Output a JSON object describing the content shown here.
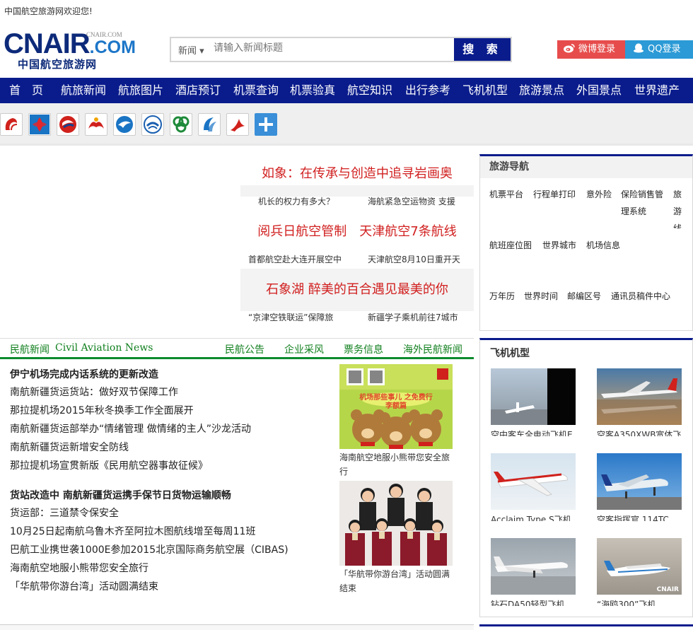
{
  "header": {
    "welcome": "中国航空旅游网欢迎您!",
    "logo_main": "CNAIR",
    "logo_dot": ".COM",
    "logo_small": "CNAIR.COM",
    "logo_cn": "中国航空旅游网"
  },
  "search": {
    "category": "新闻 ▾",
    "placeholder": "请输入新闻标题",
    "button": "搜 索"
  },
  "social": {
    "weibo": "微博登录",
    "qq": "QQ登录"
  },
  "nav": [
    "首　页",
    "航旅新闻",
    "航旅图片",
    "酒店预订",
    "机票查询",
    "机票验真",
    "航空知识",
    "出行参考",
    "飞机机型",
    "旅游景点",
    "外国景点",
    "世界遗产"
  ],
  "airlines": [
    "air-china-logo",
    "china-southern-logo",
    "china-eastern-logo",
    "hainan-airlines-logo",
    "xiamen-airlines-logo",
    "shandong-airlines-logo",
    "spring-airlines-logo",
    "sichuan-airlines-logo",
    "shenzhen-airlines-logo",
    "more-icon"
  ],
  "feature": {
    "headline1": "如象：在传承与创造中追寻岩画奥",
    "sub1a": "机长的权力有多大？",
    "sub1b": "海航紧急空运物资 支援",
    "headline2": "阅兵日航空管制　天津航空7条航线",
    "sub2a": "首都航空赴大连开展空中",
    "sub2b": "天津航空8月10日重开天",
    "headline3": "石象湖 醉美的百合遇见最美的你",
    "sub3a": "“京津空铁联运”保障旅",
    "sub3b": "新疆学子乘机前往7城市"
  },
  "travel_nav": {
    "title": "旅游导航",
    "links": [
      "机票平台",
      "行程单打印",
      "意外险",
      "保险销售管理系统",
      "旅游线",
      "航班座位图",
      "世界城市",
      "机场信息",
      "万年历",
      "世界时间",
      "邮编区号",
      "通讯员稿件中心"
    ]
  },
  "news_tabs": {
    "main": "民航新闻",
    "main_en": "Civil Aviation News",
    "tabs": [
      "民航公告",
      "企业采风",
      "票务信息",
      "海外民航新闻"
    ]
  },
  "stories_a": [
    "伊宁机场完成内话系统的更新改造",
    "南航新疆货运货站：做好双节保障工作",
    "那拉提机场2015年秋冬换季工作全面展开",
    "南航新疆货运部举办“情绪管理 做情绪的主人”沙龙活动",
    "南航新疆货运新增安全防线",
    "那拉提机场宣贯新版《民用航空器事故征候》"
  ],
  "stories_b": [
    "货站改造中 南航新疆货运携手保节日货物运输顺畅",
    "货运部：三道禁令保安全",
    "10月25日起南航乌鲁木齐至阿拉木图航线增至每周11班",
    "巴航工业携世袭1000E参加2015北京国际商务航空展（CIBAS)",
    "海南航空地服小熊带您安全旅行",
    "「华航带你游台湾」活动圆满结束"
  ],
  "pic1": {
    "caption": "海南航空地服小熊带您安全旅行",
    "poster_text": "机场那些事儿 之免费行李额篇"
  },
  "pic2": {
    "caption": "「华航带你游台湾」活动圆满结束"
  },
  "planes": {
    "title": "飞机机型",
    "items": [
      "空中客车全电动飞机E",
      "空客A350XWB宽体飞",
      "Acclaim Type S飞机",
      "空客指挥官 114TC",
      "钻石DA50轻型飞机",
      "“海鸥300”飞机"
    ],
    "watermark": "CNAIR"
  }
}
